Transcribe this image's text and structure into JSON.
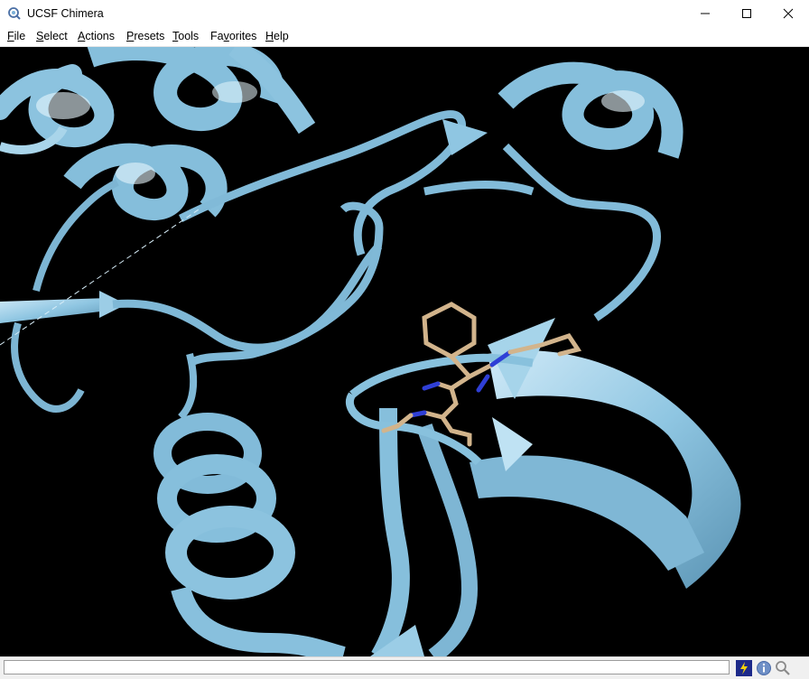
{
  "window": {
    "title": "UCSF Chimera",
    "controls": {
      "minimize": "—",
      "maximize": "☐",
      "close": "✕"
    }
  },
  "menubar": {
    "items": [
      {
        "u": "F",
        "rest": "ile"
      },
      {
        "u": "S",
        "rest": "elect"
      },
      {
        "u": "A",
        "rest": "ctions"
      },
      {
        "u": "P",
        "rest": "resets"
      },
      {
        "u": "T",
        "rest": "ools"
      },
      {
        "pre": "Fa",
        "u": "v",
        "rest": "orites"
      },
      {
        "u": "H",
        "rest": "elp"
      }
    ]
  },
  "viewer": {
    "background": "#000000",
    "ribbon_color": "#87c0de",
    "ligand_carbon_color": "#d2b48c",
    "ligand_nitrogen_color": "#2f3fd6"
  },
  "statusbar": {
    "command_value": "",
    "icons": [
      "rapid-access-icon",
      "info-icon",
      "search-icon"
    ]
  }
}
